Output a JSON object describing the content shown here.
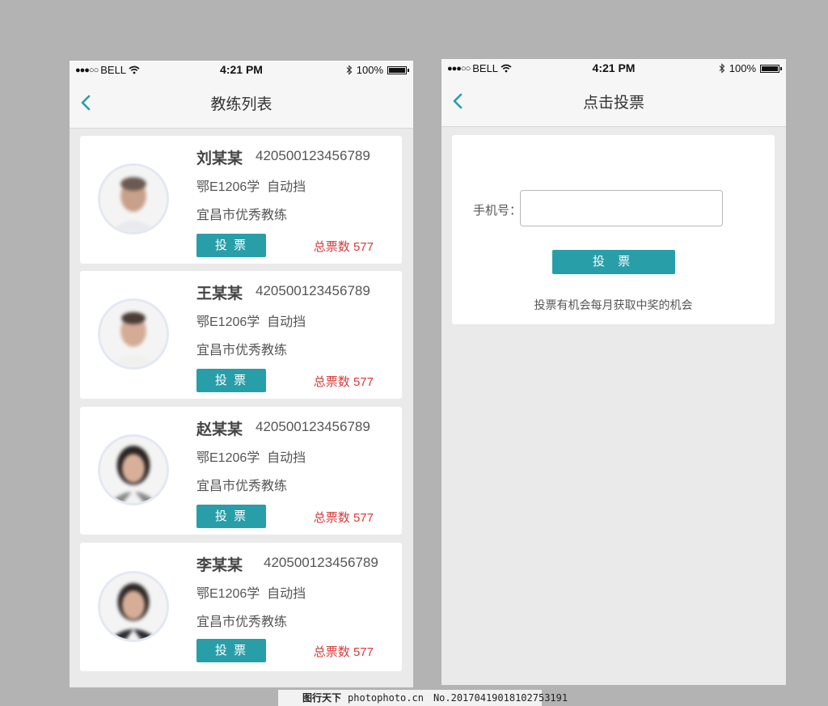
{
  "status_bar": {
    "carrier": "BELL",
    "time": "4:21 PM",
    "battery": "100%"
  },
  "coach_list_screen": {
    "title": "教练列表",
    "coaches": [
      {
        "name": "刘某某",
        "id": "420500123456789",
        "plate": "鄂E1206学",
        "transmission": "自动挡",
        "description": "宜昌市优秀教练",
        "vote_label": "投 票",
        "total_votes": "总票数 577"
      },
      {
        "name": "王某某",
        "id": "420500123456789",
        "plate": "鄂E1206学",
        "transmission": "自动挡",
        "description": "宜昌市优秀教练",
        "vote_label": "投 票",
        "total_votes": "总票数 577"
      },
      {
        "name": "赵某某",
        "id": "420500123456789",
        "plate": "鄂E1206学",
        "transmission": "自动挡",
        "description": "宜昌市优秀教练",
        "vote_label": "投 票",
        "total_votes": "总票数 577"
      },
      {
        "name": "李某某",
        "id": "420500123456789",
        "plate": "鄂E1206学",
        "transmission": "自动挡",
        "description": "宜昌市优秀教练",
        "vote_label": "投 票",
        "total_votes": "总票数 577"
      }
    ]
  },
  "vote_screen": {
    "title": "点击投票",
    "phone_label": "手机号：",
    "phone_value": "",
    "submit_label": "投 票",
    "hint": "投票有机会每月获取中奖的机会"
  },
  "watermark": {
    "brand": "图行天下",
    "site": "photophoto.cn",
    "number": "No.20170419018102753191"
  },
  "colors": {
    "accent": "#289ea9",
    "vote_count": "#d93a3a",
    "background": "#b3b3b3",
    "screen_bg": "#eaeaea"
  },
  "icons": {
    "back": "chevron-left-icon",
    "wifi": "wifi-icon",
    "bluetooth": "bluetooth-icon",
    "battery": "battery-icon"
  }
}
